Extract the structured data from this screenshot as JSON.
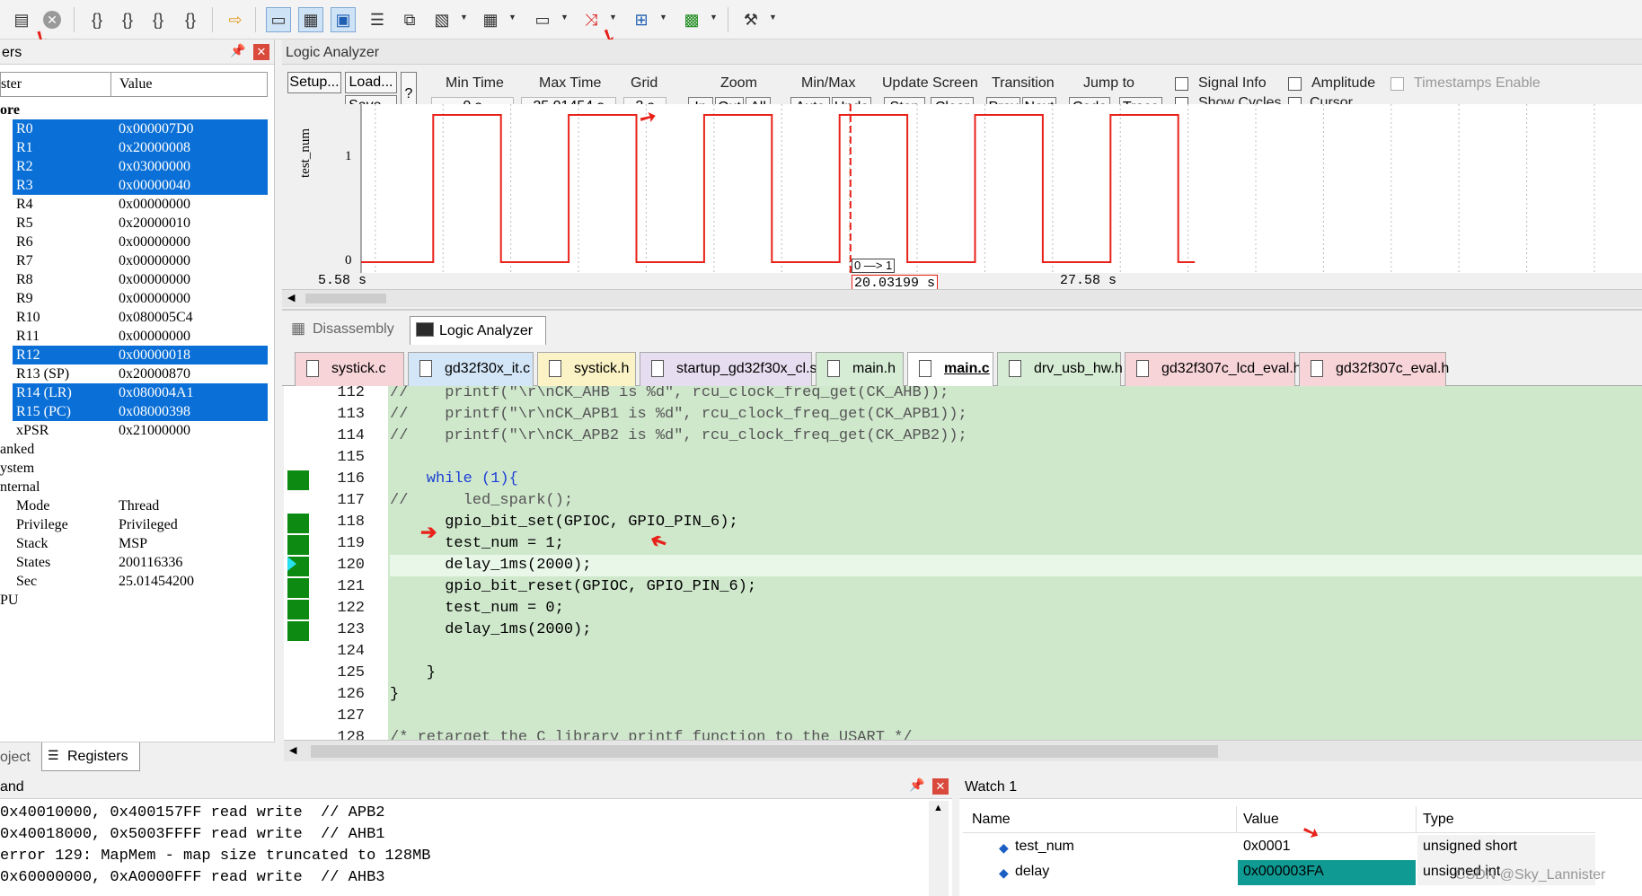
{
  "toolbar": {
    "icons": [
      "reset-icon",
      "stop-icon",
      "step-into-icon",
      "step-over-icon",
      "step-out-icon",
      "run-to-cursor-icon",
      "show-next-statement-icon",
      "command-window-icon",
      "disassembly-window-icon",
      "symbols-window-icon",
      "registers-window-icon",
      "call-stack-window-icon",
      "watch-windows-icon",
      "memory-window-icon",
      "serial-windows-icon",
      "analysis-windows-icon",
      "trace-windows-icon",
      "system-viewer-icon",
      "toolbox-icon"
    ]
  },
  "registers": {
    "title": "ers",
    "col_register": "ster",
    "col_value": "Value",
    "groups": {
      "core": "ore",
      "banked": "anked",
      "system": "ystem",
      "internal": "nternal",
      "fpu": "PU"
    },
    "rows": [
      {
        "name": "R0",
        "value": "0x000007D0",
        "selected": true
      },
      {
        "name": "R1",
        "value": "0x20000008",
        "selected": true
      },
      {
        "name": "R2",
        "value": "0x03000000",
        "selected": true
      },
      {
        "name": "R3",
        "value": "0x00000040",
        "selected": true
      },
      {
        "name": "R4",
        "value": "0x00000000",
        "selected": false
      },
      {
        "name": "R5",
        "value": "0x20000010",
        "selected": false
      },
      {
        "name": "R6",
        "value": "0x00000000",
        "selected": false
      },
      {
        "name": "R7",
        "value": "0x00000000",
        "selected": false
      },
      {
        "name": "R8",
        "value": "0x00000000",
        "selected": false
      },
      {
        "name": "R9",
        "value": "0x00000000",
        "selected": false
      },
      {
        "name": "R10",
        "value": "0x080005C4",
        "selected": false
      },
      {
        "name": "R11",
        "value": "0x00000000",
        "selected": false
      },
      {
        "name": "R12",
        "value": "0x00000018",
        "selected": true
      },
      {
        "name": "R13 (SP)",
        "value": "0x20000870",
        "selected": false
      },
      {
        "name": "R14 (LR)",
        "value": "0x080004A1",
        "selected": true
      },
      {
        "name": "R15 (PC)",
        "value": "0x08000398",
        "selected": true
      },
      {
        "name": "xPSR",
        "value": "0x21000000",
        "selected": false
      }
    ],
    "internal": [
      {
        "name": "Mode",
        "value": "Thread"
      },
      {
        "name": "Privilege",
        "value": "Privileged"
      },
      {
        "name": "Stack",
        "value": "MSP"
      },
      {
        "name": "States",
        "value": "200116336"
      },
      {
        "name": "Sec",
        "value": "25.01454200"
      }
    ],
    "tabs": {
      "project": "oject",
      "registers": "Registers"
    }
  },
  "logic_analyzer": {
    "title": "Logic Analyzer",
    "setup_label": "Setup...",
    "load_label": "Load...",
    "save_label": "Save...",
    "help_label": "?",
    "min_time_label": "Min Time",
    "min_time_value": "0 s",
    "max_time_label": "Max Time",
    "max_time_value": "25.01454 s",
    "grid_label": "Grid",
    "grid_value": "2 s",
    "zoom_label": "Zoom",
    "zoom_in": "In",
    "zoom_out": "Out",
    "zoom_all": "All",
    "minmax_label": "Min/Max",
    "minmax_auto": "Auto",
    "minmax_undo": "Undo",
    "update_label": "Update Screen",
    "update_stop": "Stop",
    "update_clear": "Clear",
    "transition_label": "Transition",
    "transition_prev": "Prev",
    "transition_next": "Next",
    "jump_label": "Jump to",
    "jump_code": "Code",
    "jump_trace": "Trace",
    "signal_info": "Signal Info",
    "show_cycles": "Show Cycles",
    "amplitude": "Amplitude",
    "cursor": "Cursor",
    "timestamps": "Timestamps Enable",
    "signal_name": "test_num",
    "y_high": "1",
    "y_low": "0",
    "t_left": "5.58 s",
    "t_cursor": "20.03199 s",
    "t_right": "27.58 s",
    "transition_tag": "0 —> 1",
    "waveform_color": "#e8221a"
  },
  "editor_tabs": {
    "disassembly": "Disassembly",
    "logic_analyzer": "Logic Analyzer",
    "files": [
      {
        "name": "systick.c",
        "bg": "#f7d4d8",
        "active": false
      },
      {
        "name": "gd32f30x_it.c",
        "bg": "#d3e6f7",
        "active": false
      },
      {
        "name": "systick.h",
        "bg": "#fbf3c5",
        "active": false
      },
      {
        "name": "startup_gd32f30x_cl.s",
        "bg": "#e6ddf0",
        "active": false
      },
      {
        "name": "main.h",
        "bg": "#d6ecd5",
        "active": false
      },
      {
        "name": "main.c",
        "bg": "#ffffff",
        "active": true
      },
      {
        "name": "drv_usb_hw.h",
        "bg": "#d6ecd5",
        "active": false
      },
      {
        "name": "gd32f307c_lcd_eval.h",
        "bg": "#f7d4d8",
        "active": false
      },
      {
        "name": "gd32f307c_eval.h",
        "bg": "#f7d4d8",
        "active": false
      }
    ]
  },
  "code": {
    "bg": "#cfe8cc",
    "lines": [
      {
        "n": "112",
        "text": "//    printf(\"\\r\\nCK_AHB is %d\", rcu_clock_freq_get(CK_AHB));"
      },
      {
        "n": "113",
        "text": "//    printf(\"\\r\\nCK_APB1 is %d\", rcu_clock_freq_get(CK_APB1));"
      },
      {
        "n": "114",
        "text": "//    printf(\"\\r\\nCK_APB2 is %d\", rcu_clock_freq_get(CK_APB2));"
      },
      {
        "n": "115",
        "text": ""
      },
      {
        "n": "116",
        "text": "    while (1){"
      },
      {
        "n": "117",
        "text": "//      led_spark();"
      },
      {
        "n": "118",
        "text": "      gpio_bit_set(GPIOC, GPIO_PIN_6);"
      },
      {
        "n": "119",
        "text": "      test_num = 1;"
      },
      {
        "n": "120",
        "text": "      delay_1ms(2000);"
      },
      {
        "n": "121",
        "text": "      gpio_bit_reset(GPIOC, GPIO_PIN_6);"
      },
      {
        "n": "122",
        "text": "      test_num = 0;"
      },
      {
        "n": "123",
        "text": "      delay_1ms(2000);"
      },
      {
        "n": "124",
        "text": ""
      },
      {
        "n": "125",
        "text": "    }"
      },
      {
        "n": "126",
        "text": "}"
      },
      {
        "n": "127",
        "text": ""
      },
      {
        "n": "128",
        "text": "/* retarget the C library printf function to the USART */"
      }
    ]
  },
  "command": {
    "title": "and",
    "lines": [
      "0x40010000, 0x400157FF read write  // APB2",
      "0x40018000, 0x5003FFFF read write  // AHB1",
      "error 129: MapMem - map size truncated to 128MB",
      "0x60000000, 0xA0000FFF read write  // AHB3"
    ]
  },
  "watch": {
    "title": "Watch 1",
    "col_name": "Name",
    "col_value": "Value",
    "col_type": "Type",
    "rows": [
      {
        "name": "test_num",
        "value": "0x0001",
        "type": "unsigned short"
      },
      {
        "name": "delay",
        "value": "0x000003FA",
        "type": "unsigned int"
      }
    ],
    "watermark": "CSDN @Sky_Lannister"
  }
}
